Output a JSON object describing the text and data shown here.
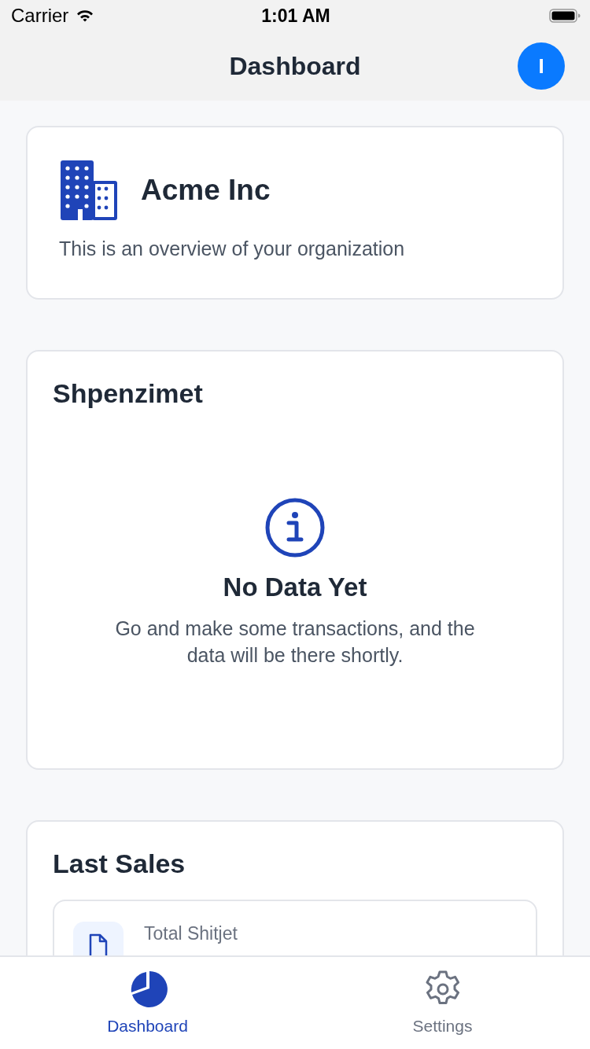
{
  "status_bar": {
    "carrier": "Carrier",
    "time": "1:01 AM"
  },
  "nav": {
    "title": "Dashboard",
    "avatar": "I"
  },
  "org_card": {
    "name": "Acme Inc",
    "description": "This is an overview of your organization"
  },
  "expenses_card": {
    "title": "Shpenzimet",
    "empty_title": "No Data Yet",
    "empty_text": "Go and make some transactions, and the data will be there shortly."
  },
  "sales_card": {
    "title": "Last Sales",
    "items": [
      {
        "label": "Total Shitjet"
      }
    ]
  },
  "tabs": [
    {
      "kind": "dashboard",
      "label": "Dashboard",
      "selected": true
    },
    {
      "kind": "settings",
      "label": "Settings",
      "selected": false
    }
  ]
}
